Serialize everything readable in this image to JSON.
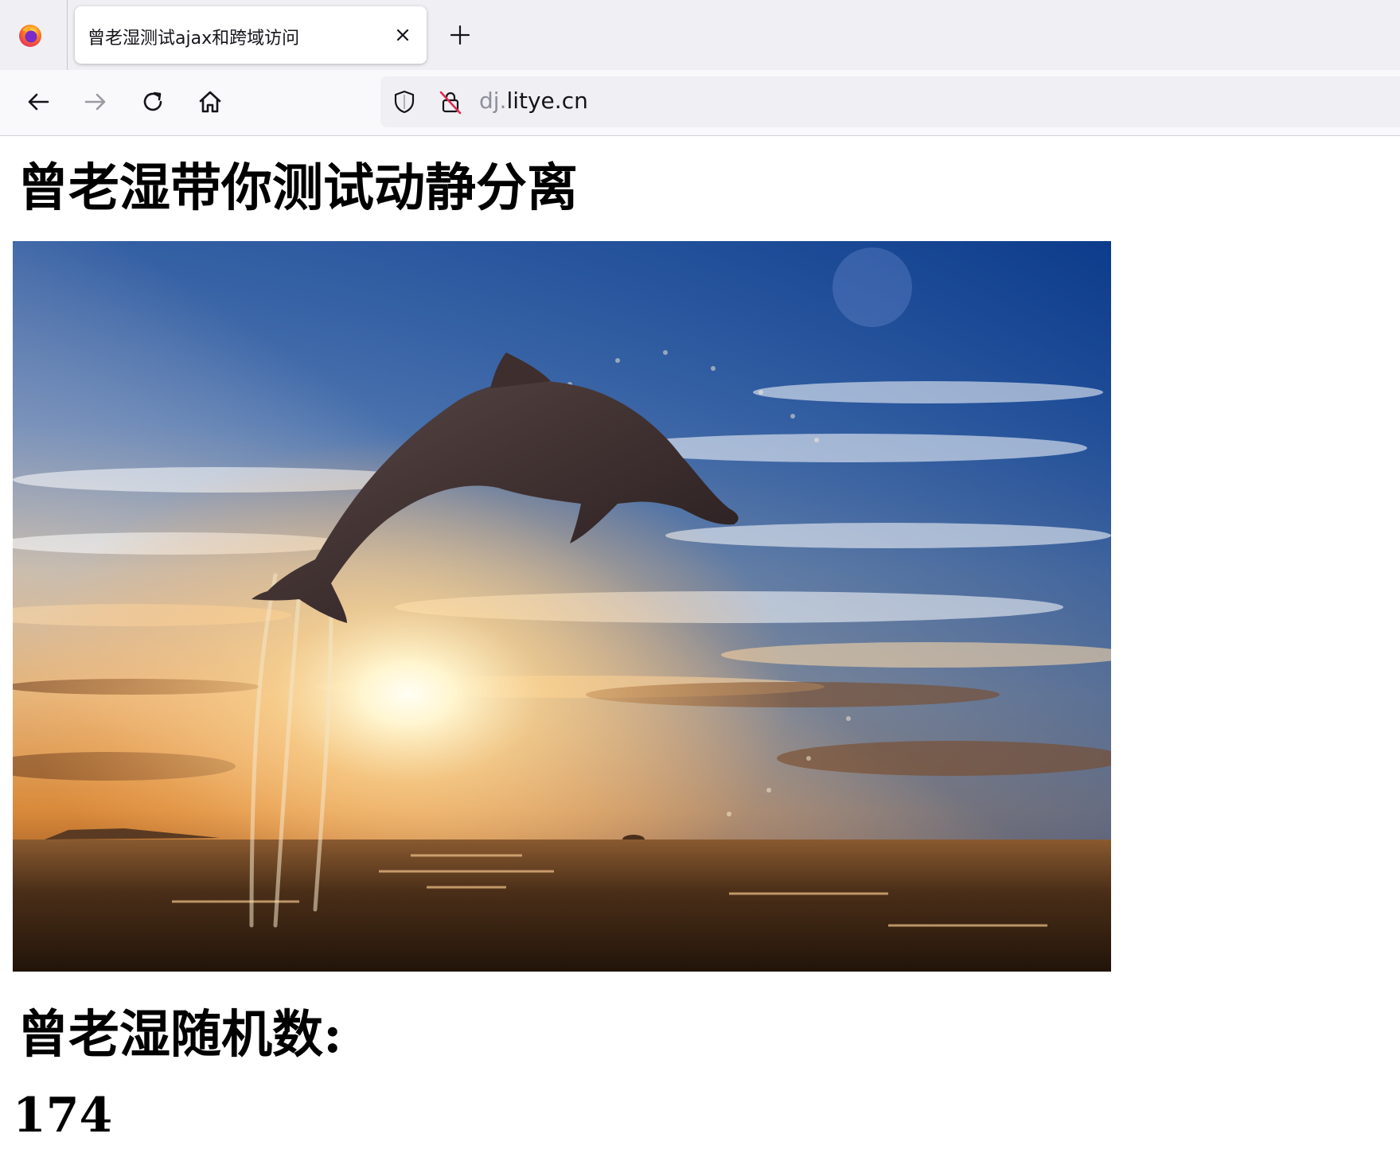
{
  "browser": {
    "tab": {
      "title": "曾老湿测试ajax和跨域访问"
    },
    "url": {
      "subdomain": "dj.",
      "domain": "litye.cn"
    },
    "icons": {
      "app": "firefox-icon",
      "close": "close-icon",
      "new_tab": "plus-icon",
      "back": "arrow-left-icon",
      "forward": "arrow-right-icon",
      "reload": "reload-icon",
      "home": "home-icon",
      "shield": "shield-icon",
      "lock": "insecure-lock-icon"
    }
  },
  "page": {
    "heading": "曾老湿带你测试动静分离",
    "random_label": "曾老湿随机数:",
    "random_value": "174"
  },
  "colors": {
    "tabstrip": "#f0f0f4",
    "navbar": "#f9f9fb",
    "urlbar": "#f0f0f4",
    "text": "#000000"
  }
}
